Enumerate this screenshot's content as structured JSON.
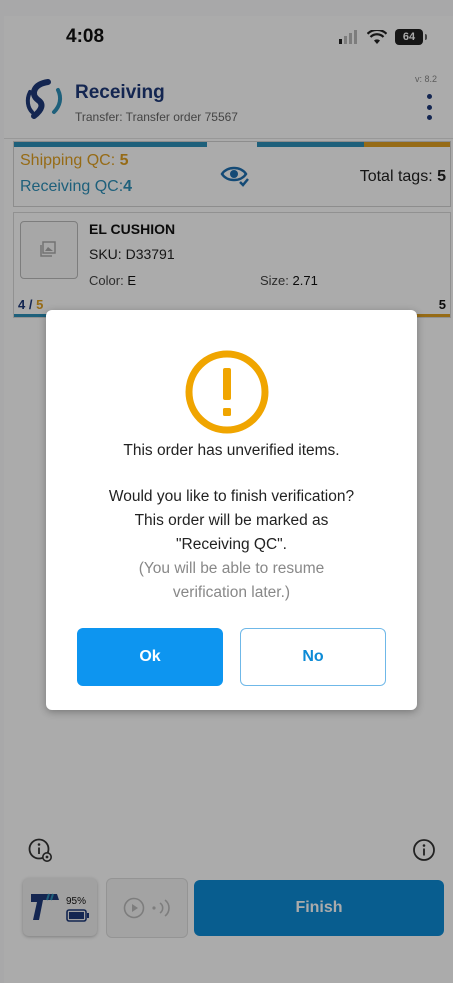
{
  "status_bar": {
    "time": "4:08",
    "battery": "64"
  },
  "header": {
    "title": "Receiving",
    "subtitle": "Transfer: Transfer order 75567",
    "version": "v: 8.2"
  },
  "summary": {
    "shipping_label": "Shipping QC:",
    "shipping_value": "5",
    "receiving_label": "Receiving QC:",
    "receiving_value": "4",
    "total_label": "Total tags:",
    "total_value": "5"
  },
  "item": {
    "name": "EL CUSHION",
    "sku_label": "SKU:",
    "sku": "D33791",
    "color_label": "Color:",
    "color": "E",
    "size_label": "Size:",
    "size": "2.71",
    "count": "4",
    "of": "5",
    "total": "5"
  },
  "dialog": {
    "line1": "This order has unverified items.",
    "line2": "Would you like to finish verification?",
    "line3": "This order will be marked as",
    "line4": "\"Receiving QC\".",
    "line5": "(You will be able to resume",
    "line6": "verification later.)",
    "ok_label": "Ok",
    "no_label": "No"
  },
  "bottom": {
    "battery_pct": "95%",
    "finish_label": "Finish"
  },
  "colors": {
    "brand_blue": "#1e3a7a",
    "receiving_blue": "#2e8fb8",
    "shipping_orange": "#e0a022",
    "action_blue": "#0d95f0"
  }
}
